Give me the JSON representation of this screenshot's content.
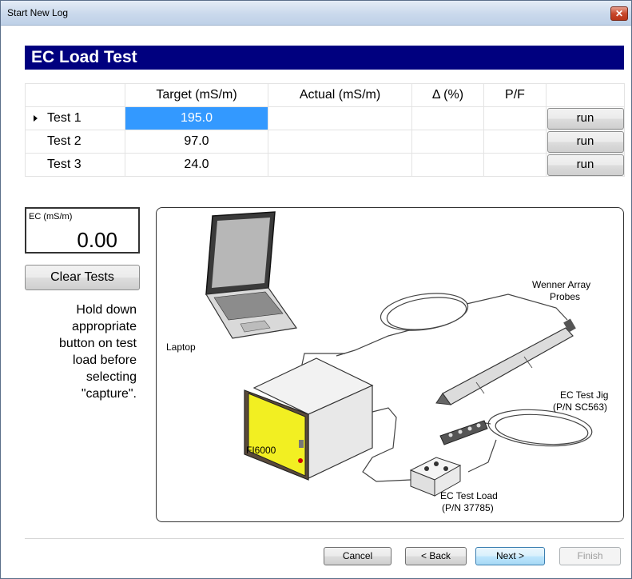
{
  "window": {
    "title": "Start New Log"
  },
  "header": {
    "title": "EC Load Test"
  },
  "table": {
    "columns": [
      "",
      "Target (mS/m)",
      "Actual (mS/m)",
      "Δ (%)",
      "P/F",
      ""
    ],
    "rows": [
      {
        "name": "Test 1",
        "target": "195.0",
        "actual": "",
        "delta": "",
        "pf": "",
        "button": "run",
        "current": true
      },
      {
        "name": "Test 2",
        "target": "97.0",
        "actual": "",
        "delta": "",
        "pf": "",
        "button": "run",
        "current": false
      },
      {
        "name": "Test 3",
        "target": "24.0",
        "actual": "",
        "delta": "",
        "pf": "",
        "button": "run",
        "current": false
      }
    ]
  },
  "ec_readout": {
    "label": "EC (mS/m)",
    "value": "0.00"
  },
  "clear_button": "Clear Tests",
  "instructions": [
    "Hold down",
    "appropriate",
    "button on test",
    "load before",
    "selecting",
    "\"capture\"."
  ],
  "diagram": {
    "labels": {
      "laptop": "Laptop",
      "device": "FI6000",
      "probes_line1": "Wenner Array",
      "probes_line2": "Probes",
      "jig_line1": "EC Test Jig",
      "jig_line2": "(P/N SC563)",
      "load_line1": "EC Test Load",
      "load_line2": "(P/N 37785)"
    },
    "device_color": "#f2ef22"
  },
  "footer": {
    "cancel": "Cancel",
    "back": "< Back",
    "next": "Next >",
    "finish": "Finish"
  }
}
